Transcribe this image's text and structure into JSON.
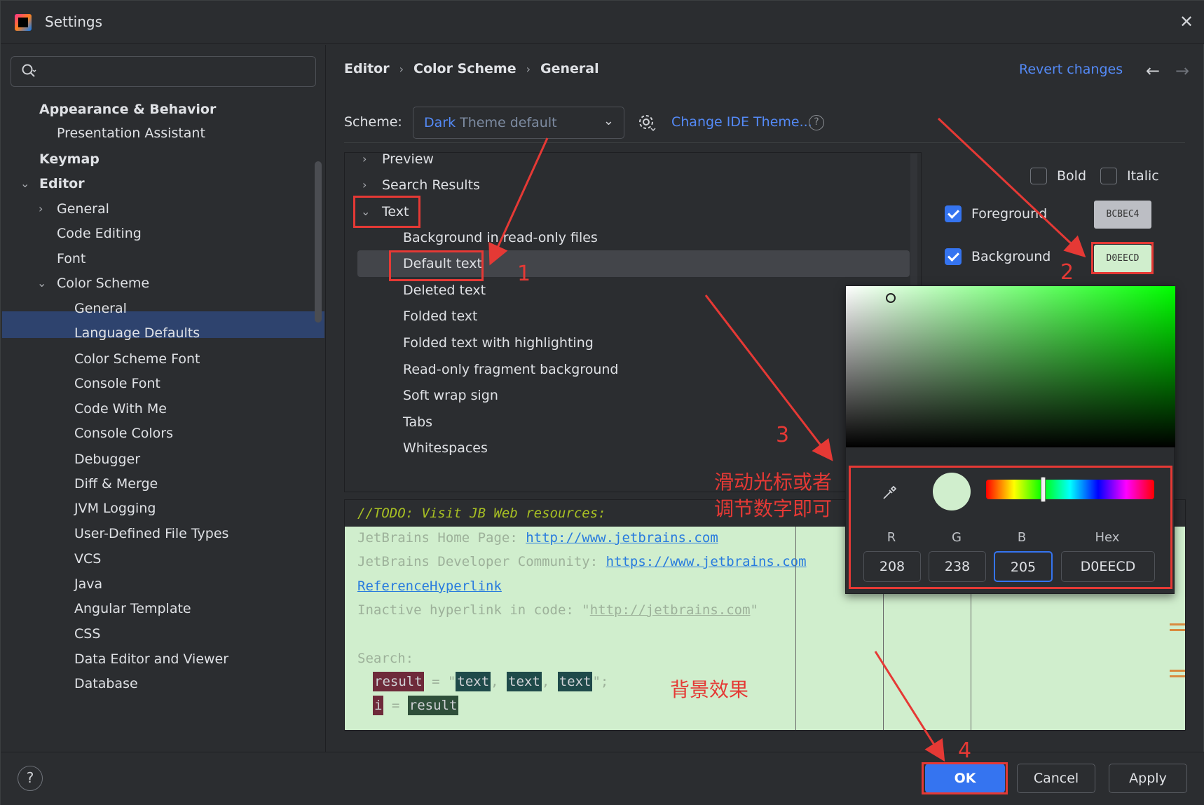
{
  "window": {
    "title": "Settings"
  },
  "search": {
    "placeholder": ""
  },
  "sidebar": {
    "items": [
      {
        "label": "Appearance & Behavior"
      },
      {
        "label": "Presentation Assistant"
      },
      {
        "label": "Keymap"
      },
      {
        "label": "Editor"
      },
      {
        "label": "General"
      },
      {
        "label": "Code Editing"
      },
      {
        "label": "Font"
      },
      {
        "label": "Color Scheme"
      },
      {
        "label": "General"
      },
      {
        "label": "Language Defaults"
      },
      {
        "label": "Color Scheme Font"
      },
      {
        "label": "Console Font"
      },
      {
        "label": "Code With Me"
      },
      {
        "label": "Console Colors"
      },
      {
        "label": "Debugger"
      },
      {
        "label": "Diff & Merge"
      },
      {
        "label": "JVM Logging"
      },
      {
        "label": "User-Defined File Types"
      },
      {
        "label": "VCS"
      },
      {
        "label": "Java"
      },
      {
        "label": "Angular Template"
      },
      {
        "label": "CSS"
      },
      {
        "label": "Data Editor and Viewer"
      },
      {
        "label": "Database"
      }
    ]
  },
  "breadcrumb": [
    "Editor",
    "Color Scheme",
    "General"
  ],
  "header": {
    "revert": "Revert changes"
  },
  "scheme": {
    "label": "Scheme:",
    "value_a": "Dark",
    "value_b": " Theme default",
    "change_theme": "Change IDE Theme..."
  },
  "options_tree": {
    "items": [
      {
        "label": "Preview"
      },
      {
        "label": "Search Results"
      },
      {
        "label": "Text"
      },
      {
        "label": "Background in read-only files"
      },
      {
        "label": "Default text"
      },
      {
        "label": "Deleted text"
      },
      {
        "label": "Folded text"
      },
      {
        "label": "Folded text with highlighting"
      },
      {
        "label": "Read-only fragment background"
      },
      {
        "label": "Soft wrap sign"
      },
      {
        "label": "Tabs"
      },
      {
        "label": "Whitespaces"
      }
    ]
  },
  "attributes": {
    "bold": "Bold",
    "italic": "Italic",
    "foreground": "Foreground",
    "foreground_hex": "BCBEC4",
    "background": "Background",
    "background_hex": "D0EECD"
  },
  "preview": {
    "todo": "//TODO: Visit JB Web resources:",
    "l1_text": "JetBrains Home Page: ",
    "l1_link": "http://www.jetbrains.com",
    "l2_text": "JetBrains Developer Community: ",
    "l2_link": "https://www.jetbrains.com",
    "l3_link": "ReferenceHyperlink",
    "l4_text": "Inactive hyperlink in code: \"",
    "l4_link": "http://jetbrains.com",
    "l4_end": "\"",
    "search": "Search:",
    "s1_var": "result",
    "s1_eq": " = \"",
    "s1_t1": "text",
    "s1_t2": "text",
    "s1_t3": "text",
    "s1_end": "\";",
    "s2_var": "i",
    "s2_eq": " = ",
    "s2_res": "result"
  },
  "picker": {
    "labels": [
      "R",
      "G",
      "B",
      "Hex"
    ],
    "values": [
      "208",
      "238",
      "205",
      "D0EECD"
    ]
  },
  "buttons": {
    "ok": "OK",
    "cancel": "Cancel",
    "apply": "Apply",
    "help": "?"
  },
  "annotations": {
    "n1": "1",
    "n2": "2",
    "n3": "3",
    "n4": "4",
    "cn1_line1": "滑动光标或者",
    "cn1_line2": "调节数字即可",
    "cn2": "背景效果"
  },
  "colors": {
    "accent": "#3574f0",
    "selection": "#2e436e",
    "annotation": "#e53935",
    "bg_color": "#d0eecd"
  }
}
